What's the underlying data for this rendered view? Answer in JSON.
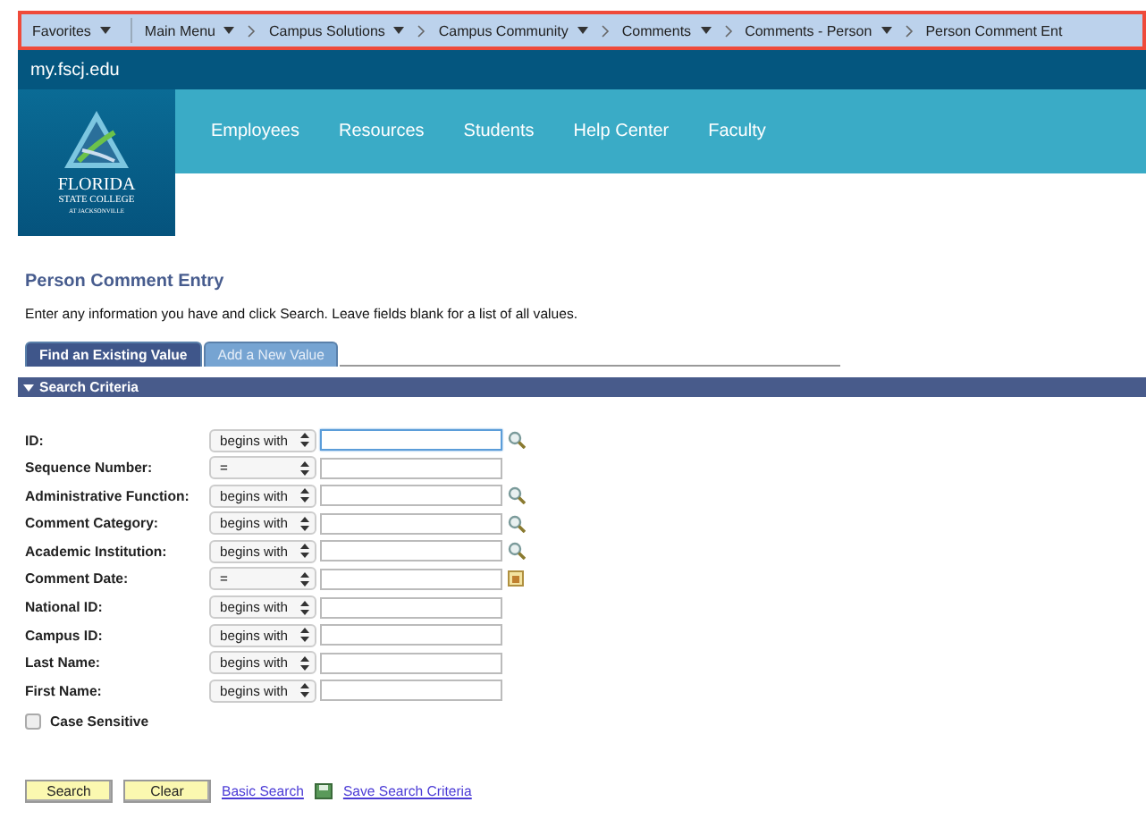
{
  "breadcrumbs": [
    {
      "label": "Favorites",
      "menu": true
    },
    {
      "label": "Main Menu",
      "menu": true
    },
    {
      "label": "Campus Solutions",
      "menu": true
    },
    {
      "label": "Campus Community",
      "menu": true
    },
    {
      "label": "Comments",
      "menu": true
    },
    {
      "label": "Comments - Person",
      "menu": true
    },
    {
      "label": "Person Comment Ent",
      "menu": false
    }
  ],
  "site": "my.fscj.edu",
  "logo": {
    "name": "FLORIDA",
    "line2": "STATE COLLEGE",
    "line3": "AT JACKSONVILLE"
  },
  "nav": [
    "Employees",
    "Resources",
    "Students",
    "Help Center",
    "Faculty"
  ],
  "page_title": "Person Comment Entry",
  "instructions": "Enter any information you have and click Search. Leave fields blank for a list of all values.",
  "tabs": [
    {
      "label": "Find an Existing Value",
      "selected": true
    },
    {
      "label": "Add a New Value",
      "selected": false
    }
  ],
  "section": "Search Criteria",
  "fields": [
    {
      "label": "ID:",
      "operator": "begins with",
      "kind": "lookup",
      "focused": true
    },
    {
      "label": "Sequence Number:",
      "operator": "=",
      "kind": "plain",
      "focused": false
    },
    {
      "label": "Administrative Function:",
      "operator": "begins with",
      "kind": "lookup",
      "focused": false
    },
    {
      "label": "Comment Category:",
      "operator": "begins with",
      "kind": "lookup",
      "focused": false
    },
    {
      "label": "Academic Institution:",
      "operator": "begins with",
      "kind": "lookup",
      "focused": false
    },
    {
      "label": "Comment Date:",
      "operator": "=",
      "kind": "calendar",
      "focused": false
    },
    {
      "label": "National ID:",
      "operator": "begins with",
      "kind": "plain",
      "focused": false
    },
    {
      "label": "Campus ID:",
      "operator": "begins with",
      "kind": "plain",
      "focused": false
    },
    {
      "label": "Last Name:",
      "operator": "begins with",
      "kind": "plain",
      "focused": false
    },
    {
      "label": "First Name:",
      "operator": "begins with",
      "kind": "plain",
      "focused": false
    }
  ],
  "case_sensitive": {
    "label": "Case Sensitive",
    "checked": false
  },
  "buttons": [
    "Search",
    "Clear"
  ],
  "links": [
    "Basic Search",
    "Save Search Criteria"
  ]
}
